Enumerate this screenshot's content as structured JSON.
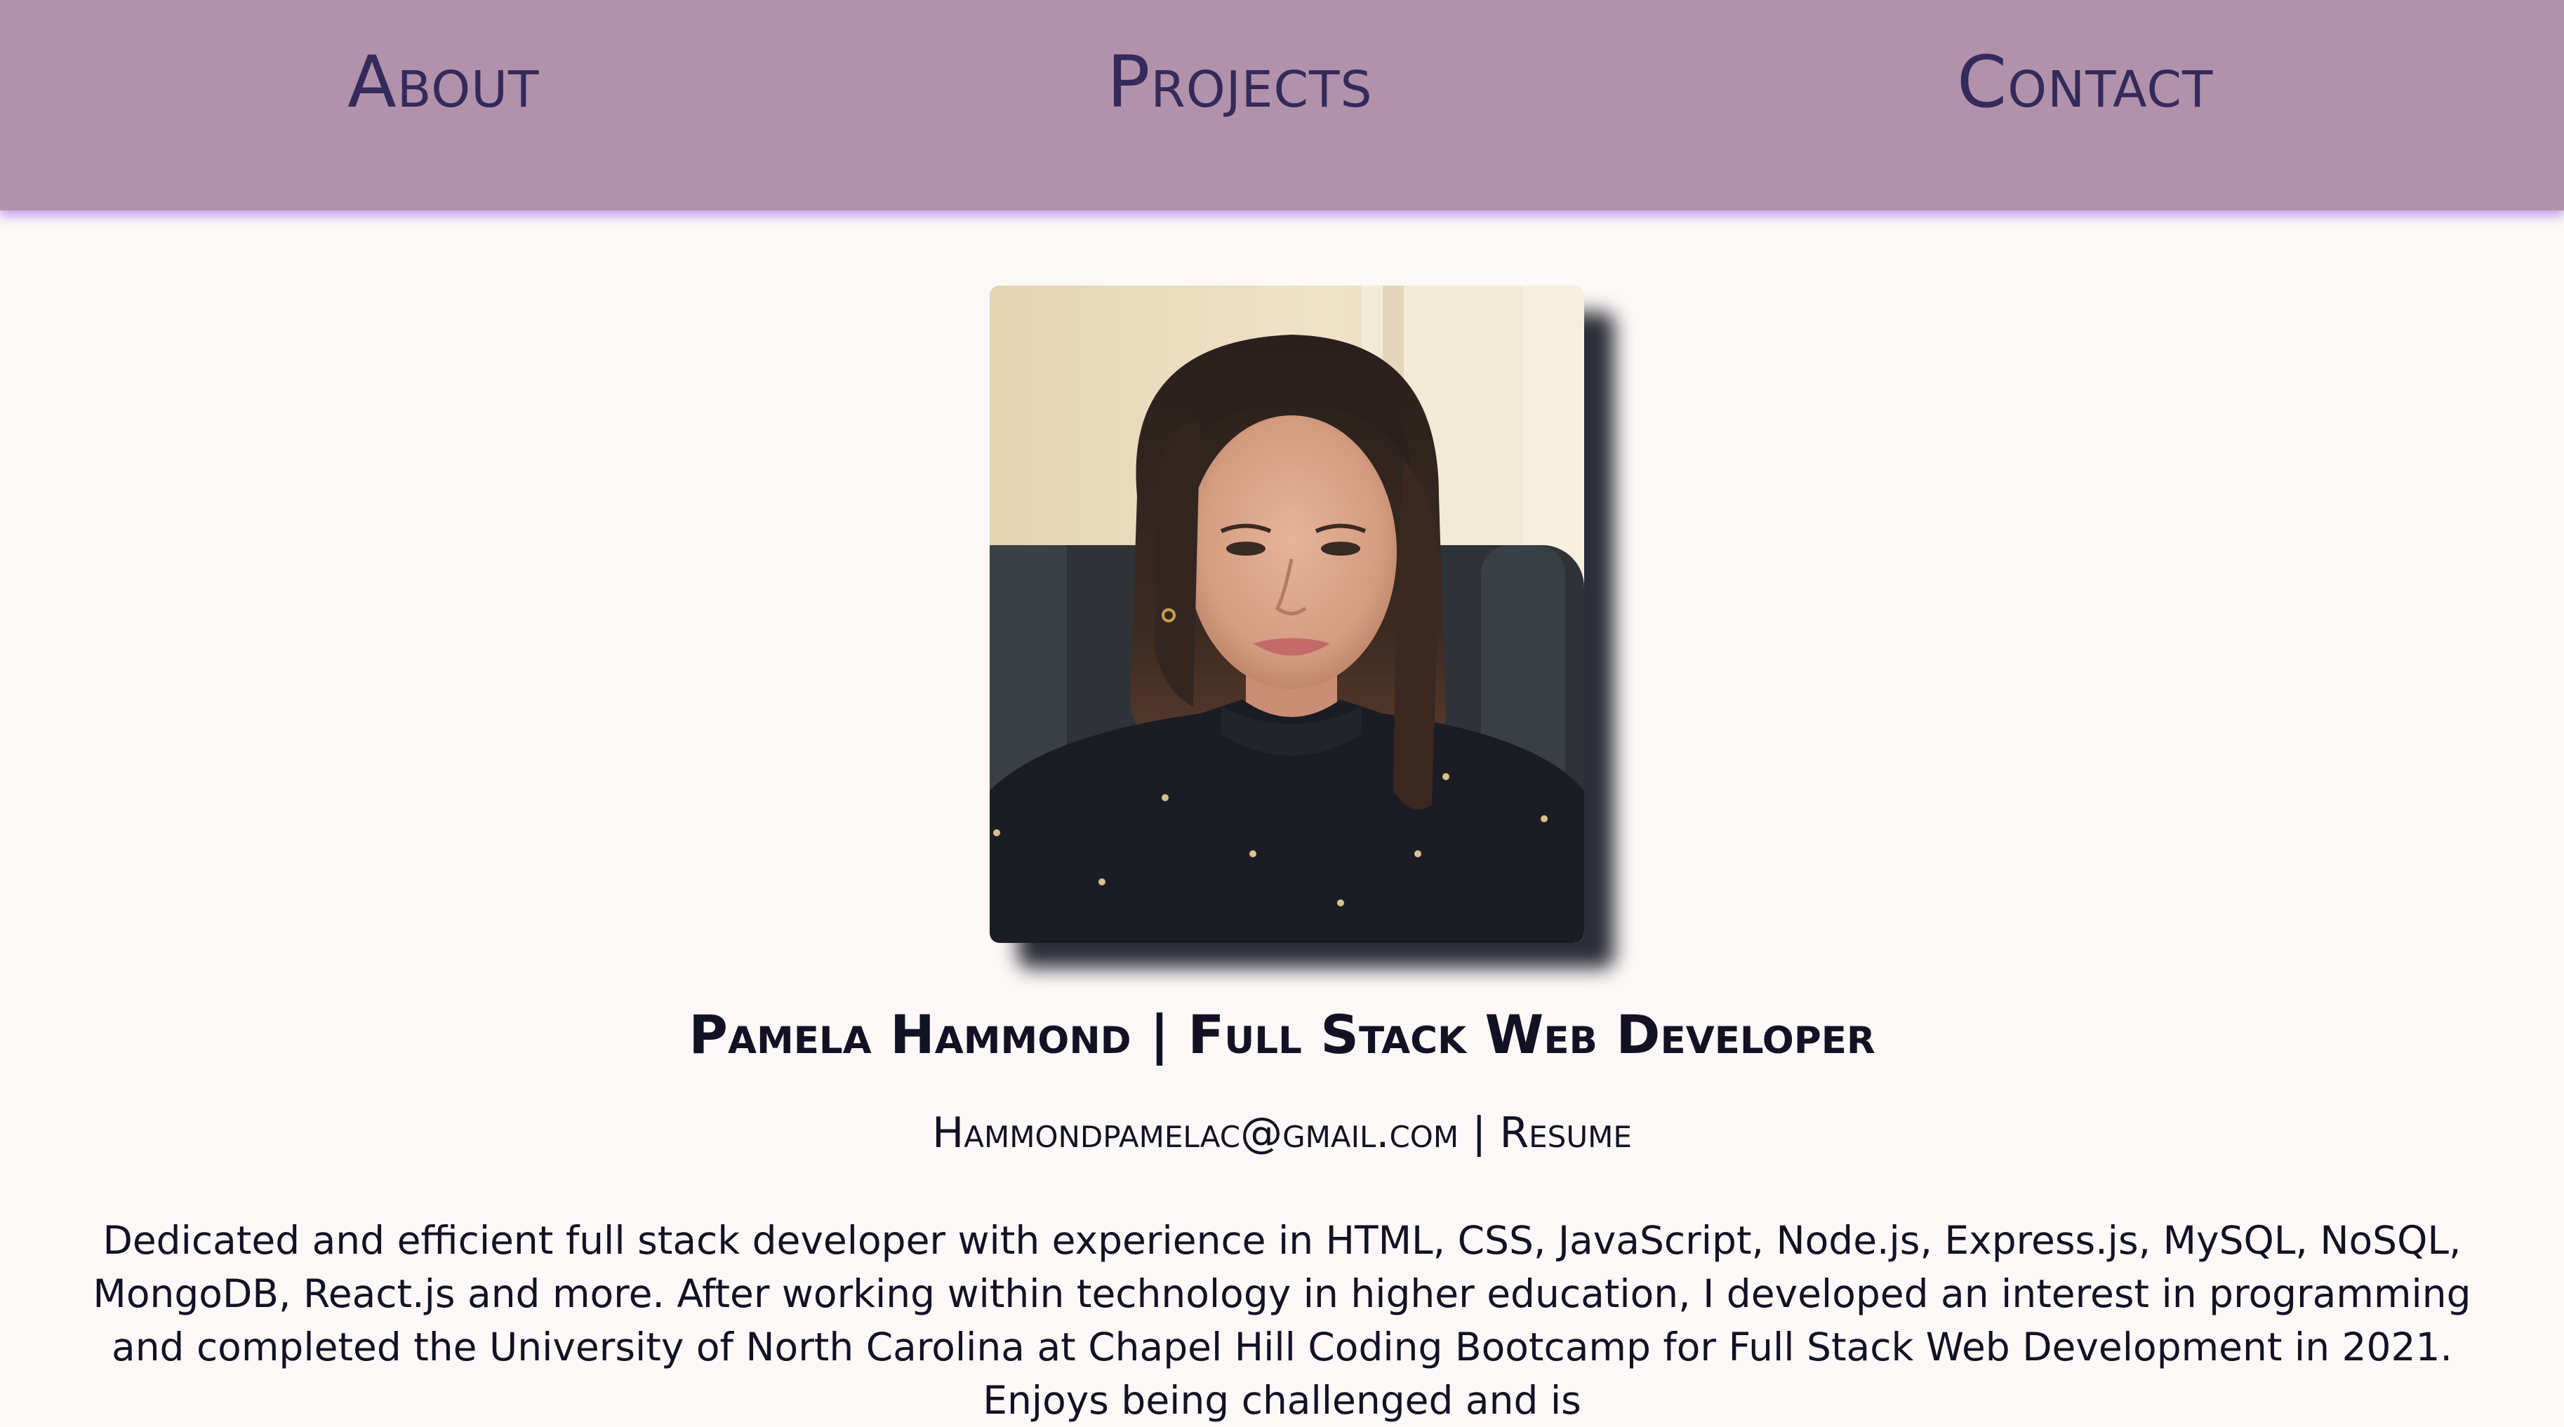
{
  "nav": {
    "about_label": "About",
    "projects_label": "Projects",
    "contact_label": "Contact"
  },
  "profile": {
    "name_title": "Pamela Hammond | Full Stack Web Developer",
    "email": "Hammondpamelac@gmail.com",
    "separator": " | ",
    "resume_label": "Resume",
    "photo_icon": "profile-photo",
    "bio": "Dedicated and efficient full stack developer with experience in HTML, CSS, JavaScript, Node.js, Express.js, MySQL, NoSQL, MongoDB, React.js and more. After working within technology in higher education, I developed an interest in programming and completed the University of North Carolina at Chapel Hill Coding Bootcamp for Full Stack Web Development in 2021. Enjoys being challenged and is"
  },
  "colors": {
    "nav_background": "#b292ab",
    "nav_text": "#342a5c",
    "page_background": "#fcf8f7",
    "nav_glow": "#9b5cf0",
    "body_text": "#121224"
  }
}
